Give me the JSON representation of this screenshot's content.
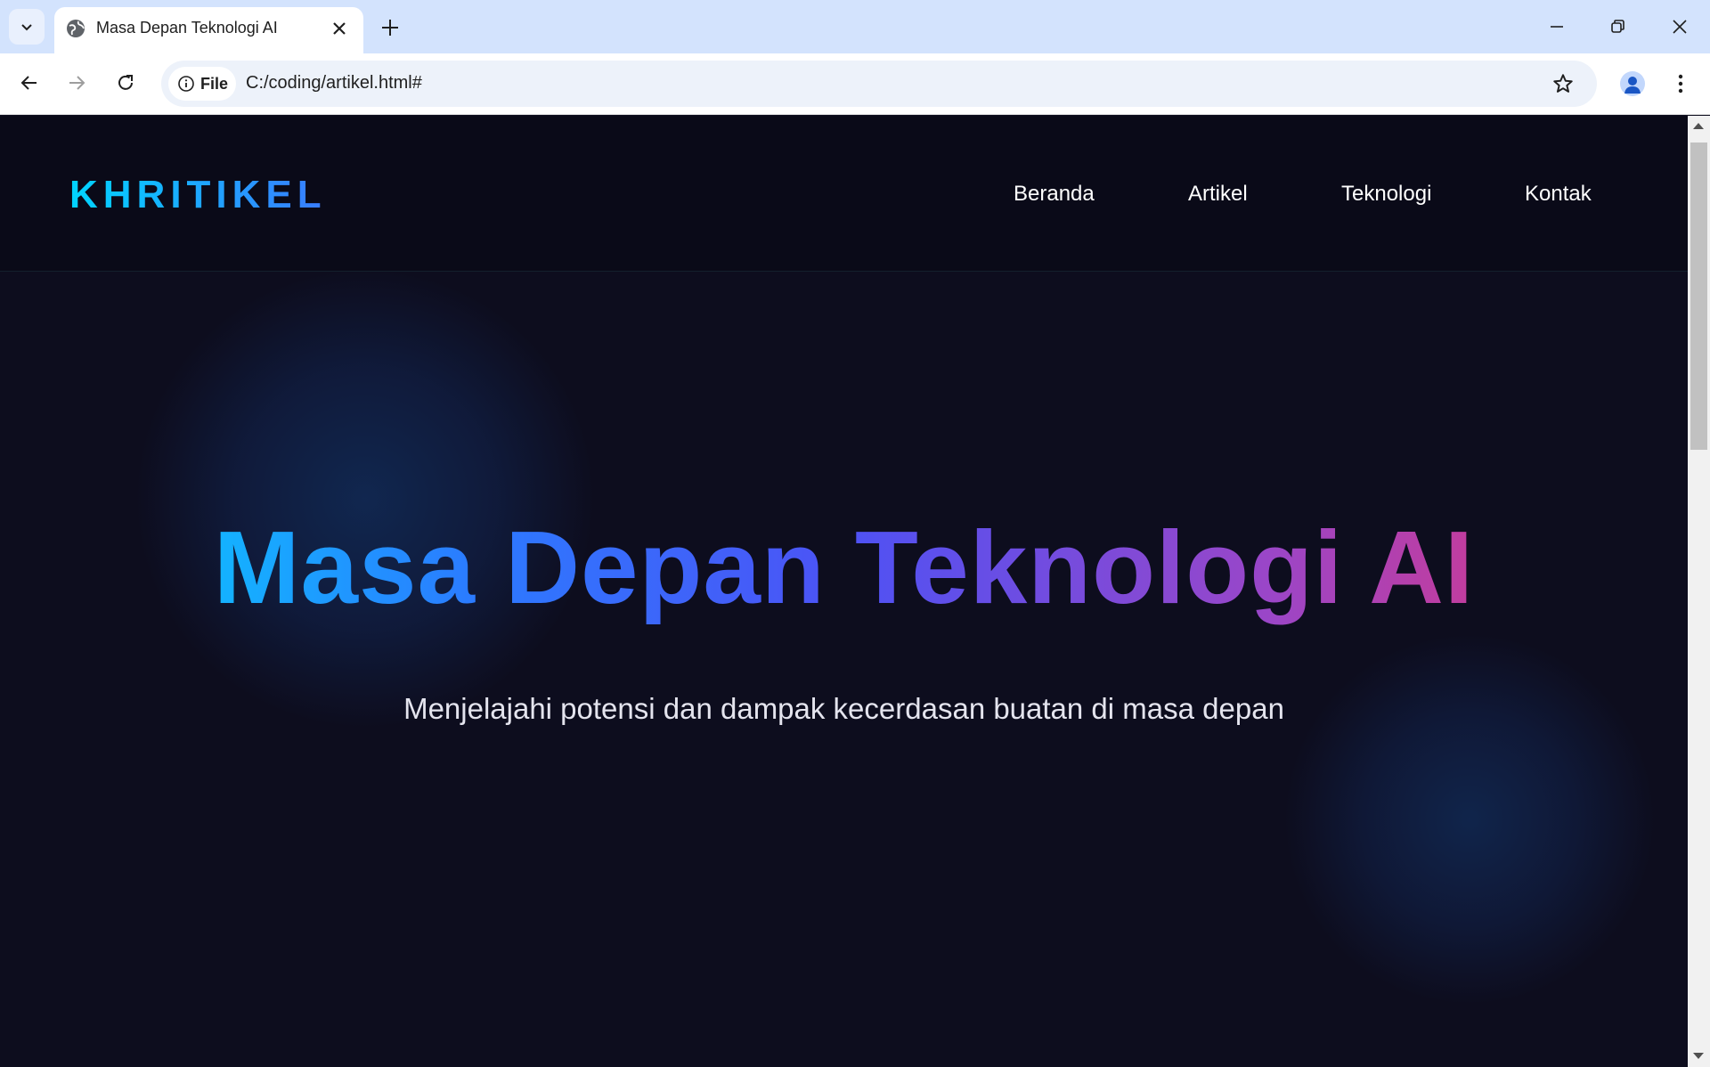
{
  "browser": {
    "tab_title": "Masa Depan Teknologi AI",
    "site_chip_label": "File",
    "url": "C:/coding/artikel.html#",
    "accent_color": "#d3e3fd"
  },
  "site": {
    "logo": "KHRITIKEL",
    "nav": [
      "Beranda",
      "Artikel",
      "Teknologi",
      "Kontak"
    ]
  },
  "hero": {
    "title": "Masa Depan Teknologi AI",
    "subtitle": "Menjelajahi potensi dan dampak kecerdasan buatan di masa depan",
    "gradient_colors": [
      "#00e1ff",
      "#2b7bff",
      "#4d52f5",
      "#9a46c8",
      "#ea3373"
    ]
  }
}
